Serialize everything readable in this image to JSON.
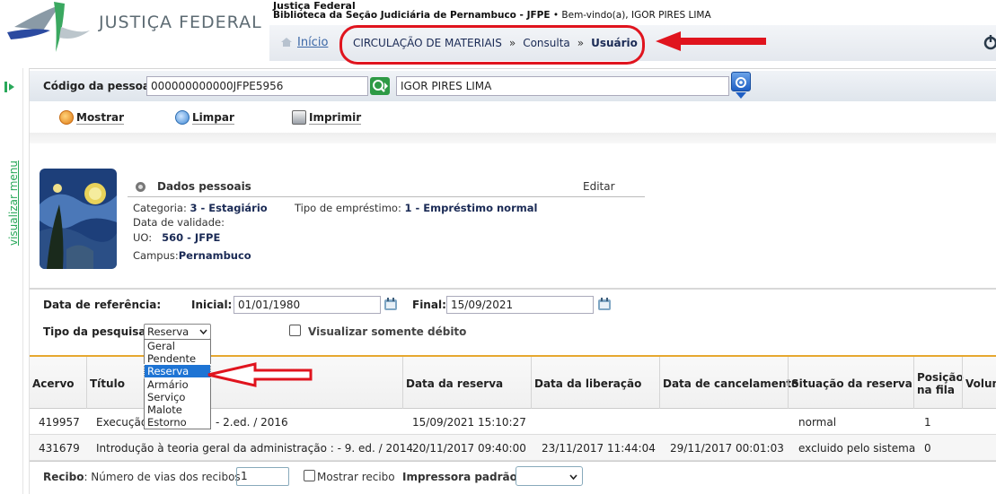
{
  "header": {
    "logo_text": "JUSTIÇA FEDERAL",
    "org_name": "Justiça Federal",
    "library_name": "Biblioteca da Seção Judiciária de Pernambuco - JFPE",
    "welcome_text": "Bem-vindo(a), IGOR PIRES LIMA",
    "home_link": "Início",
    "breadcrumb": [
      "CIRCULAÇÃO DE MATERIAIS",
      "Consulta",
      "Usuário"
    ],
    "breadcrumb_separator": "»"
  },
  "sidebar": {
    "toggle_label": "visualizar menu"
  },
  "person": {
    "code_label": "Código da pessoa:",
    "code_value": "000000000000JFPE5956",
    "name_value": "IGOR PIRES LIMA"
  },
  "toolbar": {
    "show_label": "Mostrar",
    "clear_label": "Limpar",
    "print_label": "Imprimir"
  },
  "personal_data": {
    "title": "Dados pessoais",
    "edit_label": "Editar",
    "category_label": "Categoria:",
    "category_value": "3 - Estagiário",
    "loan_type_label": "Tipo de empréstimo:",
    "loan_type_value": "1 - Empréstimo normal",
    "validity_label": "Data de validade:",
    "uo_label": "UO:",
    "uo_value": "560 - JFPE",
    "campus_label": "Campus:",
    "campus_value": "Pernambuco"
  },
  "filters": {
    "ref_date_label": "Data de referência:",
    "start_label": "Inicial:",
    "start_value": "01/01/1980",
    "end_label": "Final:",
    "end_value": "15/09/2021",
    "search_type_label": "Tipo da pesquisa:",
    "search_type_selected": "Reserva",
    "search_type_options": [
      "Geral",
      "Pendente",
      "Reserva",
      "Armário",
      "Serviço",
      "Malote",
      "Estorno"
    ],
    "debt_only_label": "Visualizar somente débito"
  },
  "table": {
    "headers": {
      "acervo": "Acervo",
      "titulo": "Título",
      "data_reserva": "Data da reserva",
      "data_liberacao": "Data da liberação",
      "data_cancelamento": "Data de cancelamento",
      "situacao": "Situação da reserva",
      "posicao_1": "Posição",
      "posicao_2": "na fila",
      "volume": "Volum"
    },
    "rows": [
      {
        "acervo": "419957",
        "titulo": "Execução",
        "titulo_tail": "- 2.ed. / 2016",
        "data_reserva": "15/09/2021 15:10:27",
        "data_liberacao": "",
        "data_cancelamento": "",
        "situacao": "normal",
        "posicao": "1"
      },
      {
        "acervo": "431679",
        "titulo": "Introdução à teoria geral da administração : - 9. ed. / 2014",
        "data_reserva": "20/11/2017 09:40:00",
        "data_liberacao": "23/11/2017 11:44:04",
        "data_cancelamento": "29/11/2017 00:01:03",
        "situacao": "excluido pelo sistema",
        "posicao": "0"
      }
    ]
  },
  "footer": {
    "receipt_label": "Recibo",
    "copies_label": ": Número de vias dos recibos",
    "copies_value": "1",
    "show_receipt_label": "Mostrar recibo",
    "printer_label": "Impressora padrão:"
  },
  "colors": {
    "annotation_red": "#e0141e",
    "selection_blue": "#1e74d4",
    "accent_orange": "#e6a830"
  }
}
